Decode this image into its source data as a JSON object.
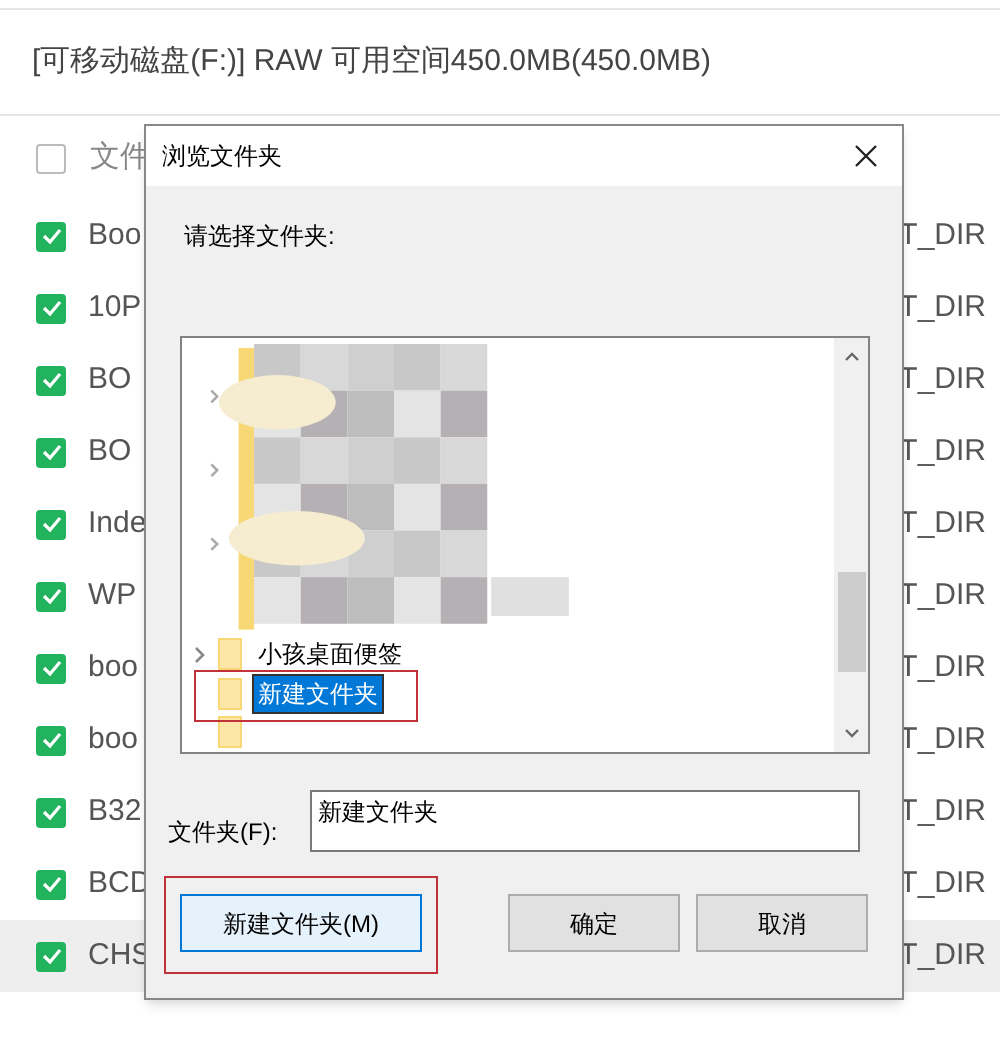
{
  "drive_info": "[可移动磁盘(F:)] RAW 可用空间450.0MB(450.0MB)",
  "file_list": {
    "header": {
      "label": "文件",
      "checked": false
    },
    "rows": [
      {
        "name": "Boo",
        "type": "T_DIR",
        "checked": true,
        "selected": false
      },
      {
        "name": "10P",
        "type": "T_DIR",
        "checked": true,
        "selected": false
      },
      {
        "name": "BO",
        "type": "T_DIR",
        "checked": true,
        "selected": false
      },
      {
        "name": "BO",
        "type": "T_DIR",
        "checked": true,
        "selected": false
      },
      {
        "name": "Inde",
        "type": "T_DIR",
        "checked": true,
        "selected": false
      },
      {
        "name": "WP",
        "type": "T_DIR",
        "checked": true,
        "selected": false
      },
      {
        "name": "boo",
        "type": "T_DIR",
        "checked": true,
        "selected": false
      },
      {
        "name": "boo",
        "type": "T_DIR",
        "checked": true,
        "selected": false
      },
      {
        "name": "B32",
        "type": "T_DIR",
        "checked": true,
        "selected": false
      },
      {
        "name": "BCD",
        "type": "T_DIR",
        "checked": true,
        "selected": false
      },
      {
        "name": "CHS",
        "type": "T_DIR",
        "checked": true,
        "selected": true
      }
    ]
  },
  "dialog": {
    "title": "浏览文件夹",
    "prompt": "请选择文件夹:",
    "tree": [
      {
        "label": "小孩桌面便签",
        "expandable": true,
        "selected": false,
        "highlighted": false
      },
      {
        "label": "新建文件夹",
        "expandable": false,
        "selected": true,
        "highlighted": true
      }
    ],
    "folder_label": "文件夹(F):",
    "folder_value": "新建文件夹",
    "buttons": [
      {
        "label": "新建文件夹(M)",
        "focused": true,
        "highlighted": true
      },
      {
        "label": "确定",
        "focused": false,
        "highlighted": false
      },
      {
        "label": "取消",
        "focused": false,
        "highlighted": false
      }
    ]
  }
}
